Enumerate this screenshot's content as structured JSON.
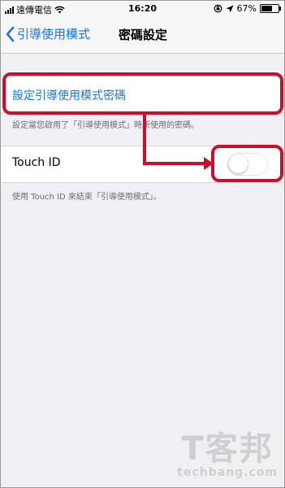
{
  "status_bar": {
    "carrier": "遠傳電信",
    "time": "16:20",
    "battery": "67%",
    "battery_level": 0.67
  },
  "nav": {
    "back_label": "引導使用模式",
    "title": "密碼設定"
  },
  "passcode_section": {
    "link_label": "設定引導使用模式密碼",
    "footer": "設定當您啟用了「引導使用模式」時所使用的密碼。"
  },
  "touch_id_section": {
    "label": "Touch ID",
    "toggle_on": false,
    "footer": "使用 Touch ID 來結束「引導使用模式」。"
  },
  "watermark": {
    "big": "T客邦",
    "small": "techbang.com"
  },
  "colors": {
    "accent": "#1a73e8",
    "highlight": "#c8102e",
    "background": "#efeff4"
  }
}
